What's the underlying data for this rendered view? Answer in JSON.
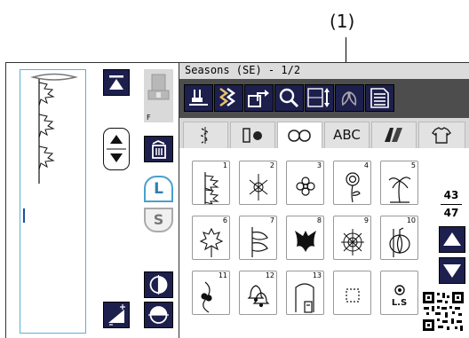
{
  "callout": {
    "label": "(1)"
  },
  "left_panel": {
    "foot_label": "F",
    "width_L": "L",
    "width_S": "S"
  },
  "header": {
    "title": "Seasons (SE) - 1/2"
  },
  "tabs": [
    {
      "label": "",
      "icon": "stitch-sewing-icon"
    },
    {
      "label": "",
      "icon": "alphabet-font-icon"
    },
    {
      "label": "",
      "icon": "decorative-knot-icon"
    },
    {
      "label": "ABC",
      "icon": ""
    },
    {
      "label": "",
      "icon": "sewing-application-icon"
    },
    {
      "label": "",
      "icon": "shirt-icon"
    }
  ],
  "patterns": [
    {
      "num": "1",
      "icon": "maple-leaf-vine-icon"
    },
    {
      "num": "2",
      "icon": "snowflake-flower-icon"
    },
    {
      "num": "3",
      "icon": "small-flower-icon"
    },
    {
      "num": "4",
      "icon": "rose-icon"
    },
    {
      "num": "5",
      "icon": "palm-tree-icon"
    },
    {
      "num": "6",
      "icon": "maple-leaf-icon"
    },
    {
      "num": "7",
      "icon": "lily-icon"
    },
    {
      "num": "8",
      "icon": "bat-icon"
    },
    {
      "num": "9",
      "icon": "spider-web-icon"
    },
    {
      "num": "10",
      "icon": "pumpkin-icon"
    },
    {
      "num": "11",
      "icon": "holly-icon"
    },
    {
      "num": "12",
      "icon": "bells-icon"
    },
    {
      "num": "13",
      "icon": "gift-house-icon"
    },
    {
      "num": "",
      "icon": "empty-slot"
    },
    {
      "num": "",
      "icon": "ls-icon",
      "label": "L.S"
    }
  ],
  "pager": {
    "current": "43",
    "total": "47"
  }
}
